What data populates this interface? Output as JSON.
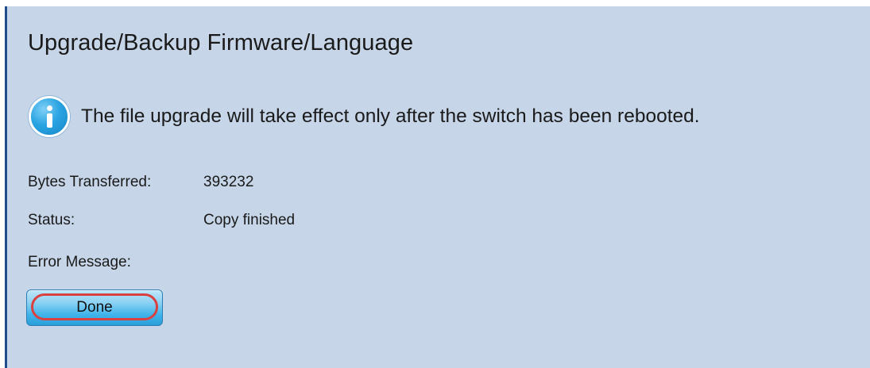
{
  "page": {
    "title": "Upgrade/Backup Firmware/Language"
  },
  "notice": {
    "icon": "info-icon",
    "text": "The file upgrade will take effect only after the switch has been rebooted."
  },
  "fields": {
    "bytes_label": "Bytes Transferred:",
    "bytes_value": "393232",
    "status_label": "Status:",
    "status_value": "Copy finished",
    "error_label": "Error Message:",
    "error_value": ""
  },
  "actions": {
    "done_label": "Done"
  },
  "colors": {
    "panel_background": "#c6d5e8",
    "highlight": "#d9403f",
    "button": "#3fb3ea"
  }
}
